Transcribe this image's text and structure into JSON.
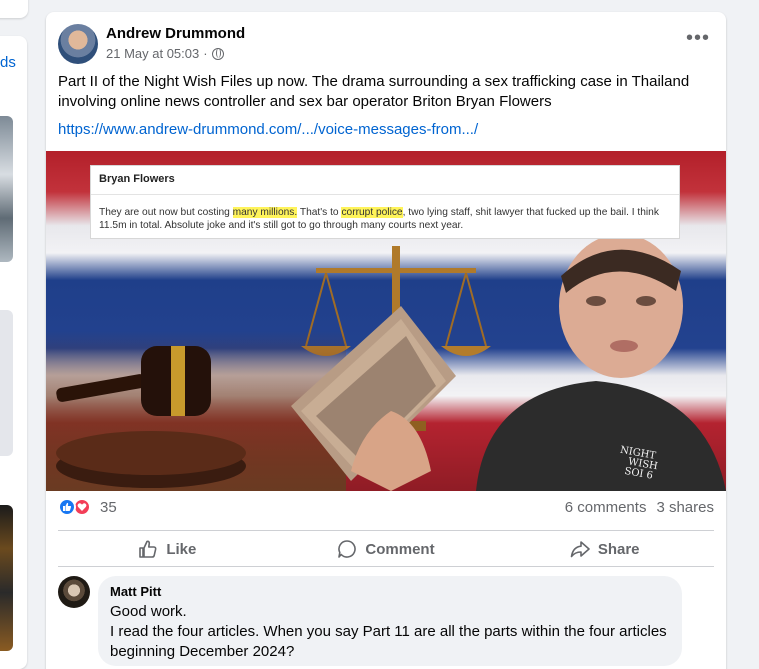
{
  "left_column": {
    "partial_text": "ds"
  },
  "post": {
    "author": "Andrew Drummond",
    "timestamp": "21 May at 05:03",
    "separator": "·",
    "audience_icon": "globe-icon",
    "more_label": "•••",
    "text": "Part II of the Night Wish Files up now. The drama surrounding a sex trafficking case in Thailand involving online news controller and sex bar operator Briton Bryan Flowers",
    "link": "https://www.andrew-drummond.com/.../voice-messages-from.../",
    "image": {
      "quote_name": "Bryan Flowers",
      "quote_before1": "They are out now but costing ",
      "quote_hl1": "many millions.",
      "quote_mid": " That's to ",
      "quote_hl2": "corrupt police",
      "quote_after": ", two lying staff, shit lawyer that fucked up the bail. I think 11.5m in total. Absolute joke and it's still got to go through many courts next year.",
      "shirt_text1": "NIGHT",
      "shirt_text2": "WISH",
      "shirt_text3": "SOI 6"
    },
    "reactions": {
      "count": "35",
      "icons": [
        "like-icon",
        "love-icon"
      ]
    },
    "stats": {
      "comments": "6 comments",
      "shares": "3 shares"
    },
    "actions": {
      "like": "Like",
      "comment": "Comment",
      "share": "Share"
    },
    "colors": {
      "accent": "#1877f2",
      "love": "#f33e58",
      "link": "#0064d1",
      "muted": "#65676b"
    }
  },
  "comment": {
    "author": "Matt Pitt",
    "line1": "Good work.",
    "line2": "I read the four articles. When you say Part 11 are all the parts within the four articles beginning December 2024?"
  }
}
